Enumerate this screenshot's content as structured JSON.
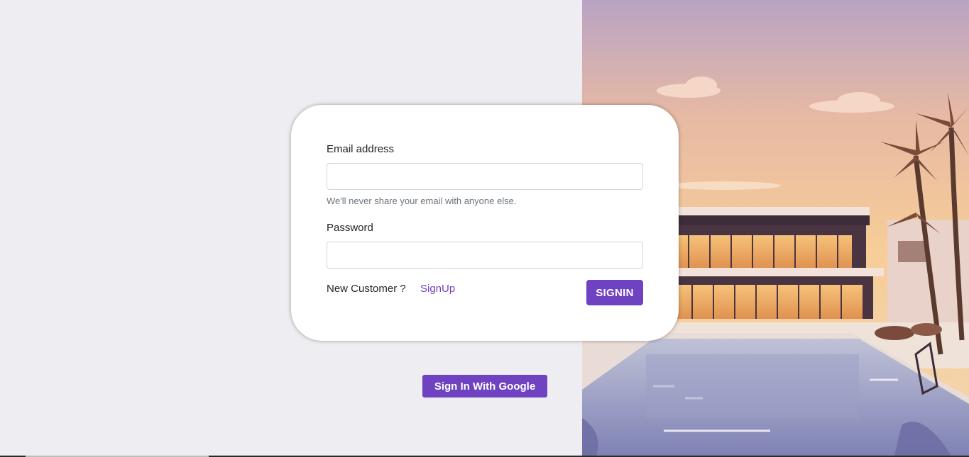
{
  "form": {
    "email_label": "Email address",
    "email_value": "",
    "email_help": "We'll never share your email with anyone else.",
    "password_label": "Password",
    "password_value": "",
    "new_customer_text": "New Customer ?",
    "signup_link": "SignUp",
    "signin_button": "SIGNIN"
  },
  "google_button": "Sign In With Google",
  "colors": {
    "accent": "#6f42c1",
    "page_background": "#eeedf1",
    "card_background": "#ffffff"
  },
  "illustration": {
    "subject": "modern-villa-with-pool-and-palm-trees"
  }
}
